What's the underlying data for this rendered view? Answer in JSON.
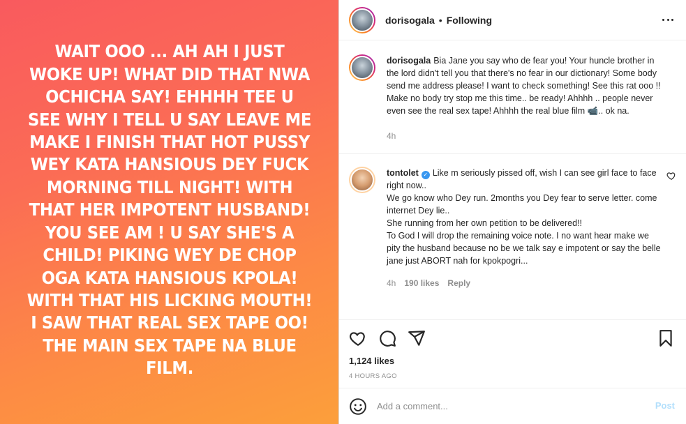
{
  "media": {
    "text": "WAIT OOO ... AH AH I JUST WOKE UP! WHAT DID THAT NWA OCHICHA SAY! EHHHH TEE U SEE WHY I TELL U SAY LEAVE ME MAKE I FINISH THAT HOT PUSSY WEY KATA HANSIOUS DEY FUCK MORNING TILL NIGHT! WITH THAT HER IMPOTENT HUSBAND! YOU SEE AM ! U SAY SHE'S A CHILD! PIKING WEY DE CHOP OGA KATA HANSIOUS KPOLA! WITH THAT HIS LICKING MOUTH! I SAW THAT REAL SEX TAPE OO! THE MAIN SEX TAPE NA BLUE FILM."
  },
  "header": {
    "username": "dorisogala",
    "dot": "•",
    "follow_status": "Following"
  },
  "caption": {
    "username": "dorisogala",
    "text": "Bia Jane you say who de fear you! Your huncle brother in the lord didn't tell you that there's no fear in our dictionary! Some body send me address please! I want to check something! See this rat ooo !! Make no body try stop me this time.. be ready! Ahhhh .. people never even see the real sex tape! Ahhhh the real blue film 📹.. ok na.",
    "time": "4h"
  },
  "comments": [
    {
      "username": "tontolet",
      "verified_mark": "✓",
      "text": "Like m seriously pissed off, wish I can see girl face to face right now..\nWe go know who Dey run. 2months you Dey fear to serve letter. come internet Dey lie..\nShe running from her own petition to be delivered!!\nTo God I will drop the remaining voice note. I no want hear make we pity the husband because no be we talk say e impotent or say the belle jane just ABORT nah for kpokpogri...",
      "time": "4h",
      "likes": "190 likes",
      "reply_label": "Reply"
    }
  ],
  "engagement": {
    "likes": "1,124 likes",
    "posted_ago": "4 HOURS AGO"
  },
  "composer": {
    "placeholder": "Add a comment...",
    "post_label": "Post"
  },
  "colors": {
    "gradient_top": "#f95a5e",
    "gradient_bottom": "#fc9f3b",
    "verified": "#3897f0",
    "post_disabled": "#b2dffc"
  },
  "icons": [
    "more-options-icon",
    "heart-icon",
    "comment-icon",
    "share-icon",
    "bookmark-icon",
    "emoji-icon",
    "verified-badge-icon"
  ]
}
